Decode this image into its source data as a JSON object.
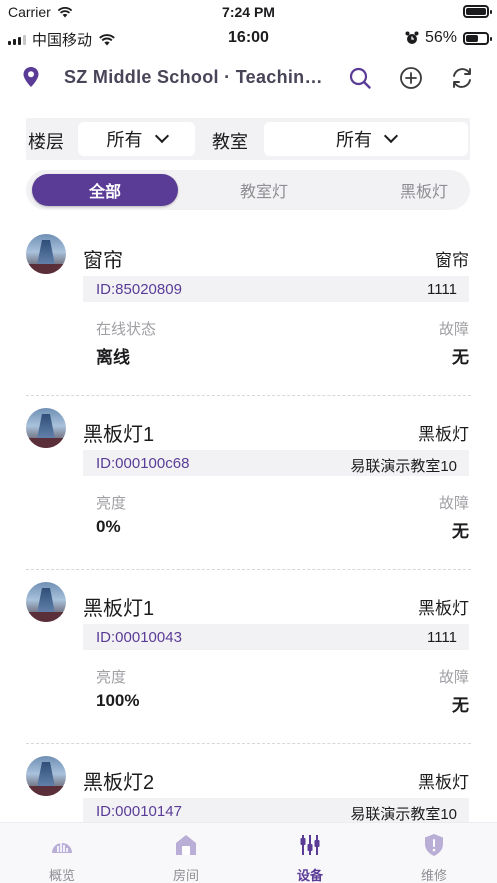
{
  "status_bar": {
    "carrier": "Carrier",
    "time": "7:24 PM"
  },
  "device_status_bar": {
    "carrier": "中国移动",
    "time": "16:00",
    "battery": "56%"
  },
  "header": {
    "title": "SZ Middle School · Teaching Building",
    "icons": [
      "location-pin-icon",
      "search-icon",
      "add-icon",
      "refresh-icon"
    ]
  },
  "filter": {
    "floor_label": "楼层",
    "floor_value": "所有",
    "classroom_label": "教室",
    "classroom_value": "所有"
  },
  "tabs": [
    {
      "label": "全部",
      "active": true
    },
    {
      "label": "教室灯",
      "active": false
    },
    {
      "label": "黑板灯",
      "active": false
    }
  ],
  "devices": [
    {
      "name": "窗帘",
      "type": "窗帘",
      "id": "ID:85020809",
      "room": "1111",
      "key1": "在线状态",
      "val1": "离线",
      "key2": "故障",
      "val2": "无"
    },
    {
      "name": "黑板灯1",
      "type": "黑板灯",
      "id": "ID:000100c68",
      "room": "易联演示教室10",
      "key1": "亮度",
      "val1": "0%",
      "key2": "故障",
      "val2": "无"
    },
    {
      "name": "黑板灯1",
      "type": "黑板灯",
      "id": "ID:00010043",
      "room": "1111",
      "key1": "亮度",
      "val1": "100%",
      "key2": "故障",
      "val2": "无"
    },
    {
      "name": "黑板灯2",
      "type": "黑板灯",
      "id": "ID:00010147",
      "room": "易联演示教室10",
      "key1": "",
      "val1": "",
      "key2": "",
      "val2": ""
    }
  ],
  "nav": [
    {
      "label": "概览",
      "icon": "overview-chart-icon",
      "active": false
    },
    {
      "label": "房间",
      "icon": "room-house-icon",
      "active": false
    },
    {
      "label": "设备",
      "icon": "device-sliders-icon",
      "active": true
    },
    {
      "label": "维修",
      "icon": "repair-shield-icon",
      "active": false
    }
  ],
  "colors": {
    "accent": "#5a3c97",
    "accent_light": "#b8aed6",
    "muted": "#8e8e93"
  }
}
